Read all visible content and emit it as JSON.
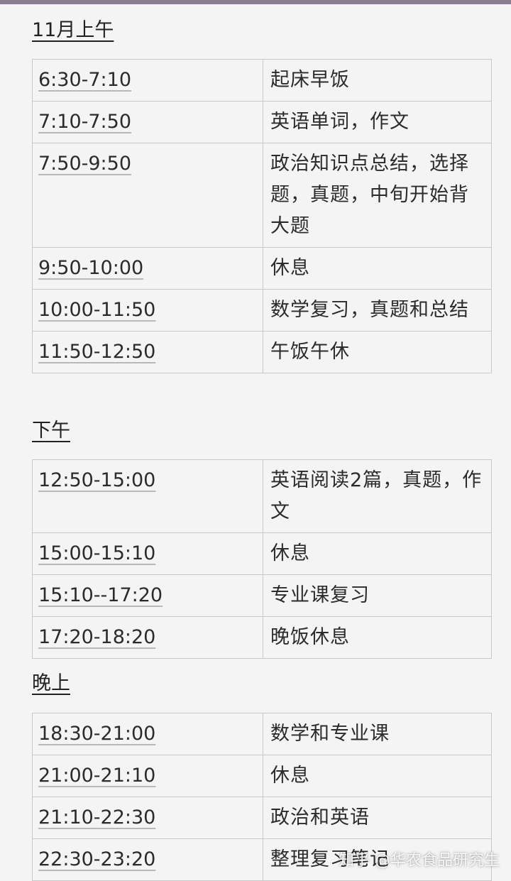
{
  "sections": [
    {
      "heading": "11月上午",
      "rows": [
        {
          "time": "6:30-7:10",
          "activity": "起床早饭"
        },
        {
          "time": "7:10-7:50",
          "activity": "英语单词，作文"
        },
        {
          "time": "7:50-9:50",
          "activity": "政治知识点总结，选择题，真题，中旬开始背大题"
        },
        {
          "time": "9:50-10:00",
          "activity": "休息"
        },
        {
          "time": "10:00-11:50",
          "activity": "数学复习，真题和总结"
        },
        {
          "time": "11:50-12:50",
          "activity": "午饭午休"
        }
      ]
    },
    {
      "heading": "下午",
      "rows": [
        {
          "time": "12:50-15:00",
          "activity": "英语阅读2篇，真题，作文"
        },
        {
          "time": "15:00-15:10",
          "activity": "休息"
        },
        {
          "time": "15:10--17:20",
          "activity": "专业课复习"
        },
        {
          "time": "17:20-18:20",
          "activity": "晚饭休息"
        }
      ]
    },
    {
      "heading": "晚上",
      "rows": [
        {
          "time": "18:30-21:00",
          "activity": "数学和专业课"
        },
        {
          "time": "21:00-21:10",
          "activity": "休息"
        },
        {
          "time": "21:10-22:30",
          "activity": "政治和英语"
        },
        {
          "time": "22:30-23:20",
          "activity": "整理复习笔记"
        }
      ]
    }
  ],
  "watermark": "知乎 @华农食品研究生",
  "colors": {
    "background": "#f4f4f4",
    "top_bar": "#8d7d91",
    "grid_line": "#c9c9c9"
  }
}
